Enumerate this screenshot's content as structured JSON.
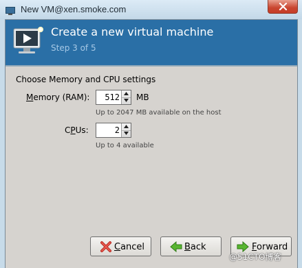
{
  "window": {
    "title": "New VM@xen.smoke.com",
    "close_icon": "close-icon"
  },
  "header": {
    "title": "Create a new virtual machine",
    "step": "Step 3 of 5",
    "icon": "monitor-play-icon",
    "banner_color": "#2a6fa6"
  },
  "content": {
    "heading": "Choose Memory and CPU settings",
    "memory": {
      "label_mnemonic": "M",
      "label_rest": "emory (RAM):",
      "value": "512",
      "unit": "MB",
      "hint": "Up to 2047 MB available on the host"
    },
    "cpus": {
      "label_pre": "C",
      "label_mnemonic": "P",
      "label_rest": "Us:",
      "value": "2",
      "hint": "Up to 4 available"
    }
  },
  "buttons": {
    "cancel_mnemonic": "C",
    "cancel_rest": "ancel",
    "back_mnemonic": "B",
    "back_rest": "ack",
    "forward_mnemonic": "F",
    "forward_rest": "orward"
  },
  "watermark": "@51CTO博客"
}
